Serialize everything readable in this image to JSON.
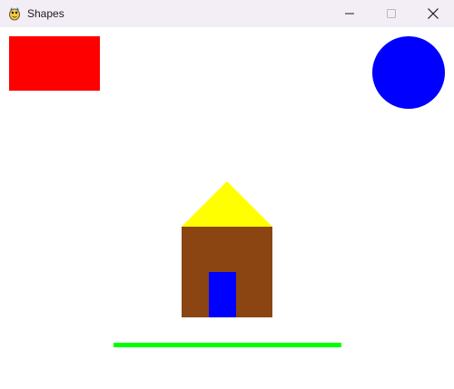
{
  "window": {
    "title": "Shapes",
    "icon": "pygame-snake-icon",
    "controls": {
      "minimize_icon": "minimize-icon",
      "maximize_icon": "maximize-icon",
      "close_icon": "close-icon"
    }
  },
  "colors": {
    "titlebar_bg": "#f3eef6",
    "canvas_bg": "#ffffff",
    "red_rect": "#ff0000",
    "blue_circle": "#0000ff",
    "roof": "#ffff00",
    "house_body": "#8b4513",
    "door": "#0000ff",
    "ground_line": "#00ff00"
  },
  "shapes": [
    {
      "name": "red-rectangle",
      "kind": "rectangle",
      "color": "#ff0000"
    },
    {
      "name": "blue-circle",
      "kind": "circle",
      "color": "#0000ff"
    },
    {
      "name": "house-roof",
      "kind": "triangle",
      "color": "#ffff00"
    },
    {
      "name": "house-body",
      "kind": "rectangle",
      "color": "#8b4513"
    },
    {
      "name": "house-door",
      "kind": "rectangle",
      "color": "#0000ff"
    },
    {
      "name": "ground-line",
      "kind": "line",
      "color": "#00ff00"
    }
  ]
}
